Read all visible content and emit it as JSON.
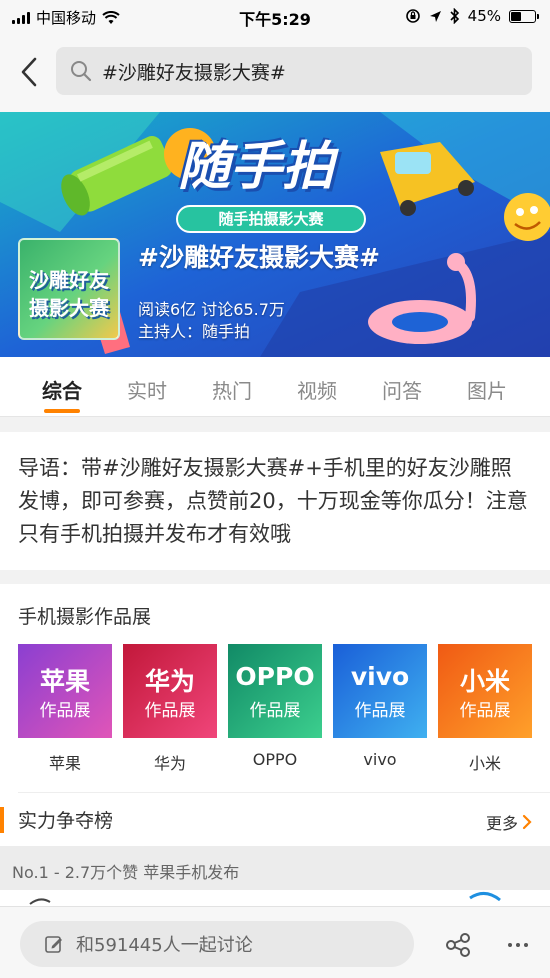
{
  "status_bar": {
    "carrier": "中国移动",
    "time": "下午5:29",
    "battery": "45%",
    "battery_level": 0.45
  },
  "search": {
    "query": "#沙雕好友摄影大赛#"
  },
  "banner": {
    "logo_title": "随手拍",
    "logo_subtitle": "随手拍摄影大赛",
    "thumb_line1": "沙雕好友",
    "thumb_line2": "摄影大赛",
    "topic_title": "#沙雕好友摄影大赛#",
    "stats": "阅读6亿  讨论65.7万",
    "host": "主持人：随手拍"
  },
  "tabs": [
    {
      "label": "综合",
      "active": true
    },
    {
      "label": "实时",
      "active": false
    },
    {
      "label": "热门",
      "active": false
    },
    {
      "label": "视频",
      "active": false
    },
    {
      "label": "问答",
      "active": false
    },
    {
      "label": "图片",
      "active": false
    }
  ],
  "intro": {
    "text": "导语：带#沙雕好友摄影大赛#+手机里的好友沙雕照发博，即可参赛，点赞前20，十万现金等你瓜分！注意只有手机拍摄并发布才有效哦"
  },
  "gallery": {
    "title": "手机摄影作品展",
    "brands": [
      {
        "big": "苹果",
        "small": "作品展",
        "label": "苹果",
        "colors": [
          "#8b3fd1",
          "#e055b8"
        ]
      },
      {
        "big": "华为",
        "small": "作品展",
        "label": "华为",
        "colors": [
          "#c2183a",
          "#f0457a"
        ]
      },
      {
        "big": "OPPO",
        "small": "作品展",
        "label": "OPPO",
        "colors": [
          "#118a66",
          "#3ccf8e"
        ]
      },
      {
        "big": "vivo",
        "small": "作品展",
        "label": "vivo",
        "colors": [
          "#1a5fd8",
          "#3fb0f0"
        ]
      },
      {
        "big": "小米",
        "small": "作品展",
        "label": "小米",
        "colors": [
          "#f05a14",
          "#ffa02a"
        ]
      }
    ]
  },
  "ranking": {
    "title": "实力争夺榜",
    "more": "更多",
    "top_entry": "No.1 - 2.7万个赞  苹果手机发布"
  },
  "bottom_bar": {
    "comment_placeholder": "和591445人一起讨论"
  },
  "colors": {
    "accent": "#ff8200",
    "banner_blue": "#1e63d6"
  }
}
